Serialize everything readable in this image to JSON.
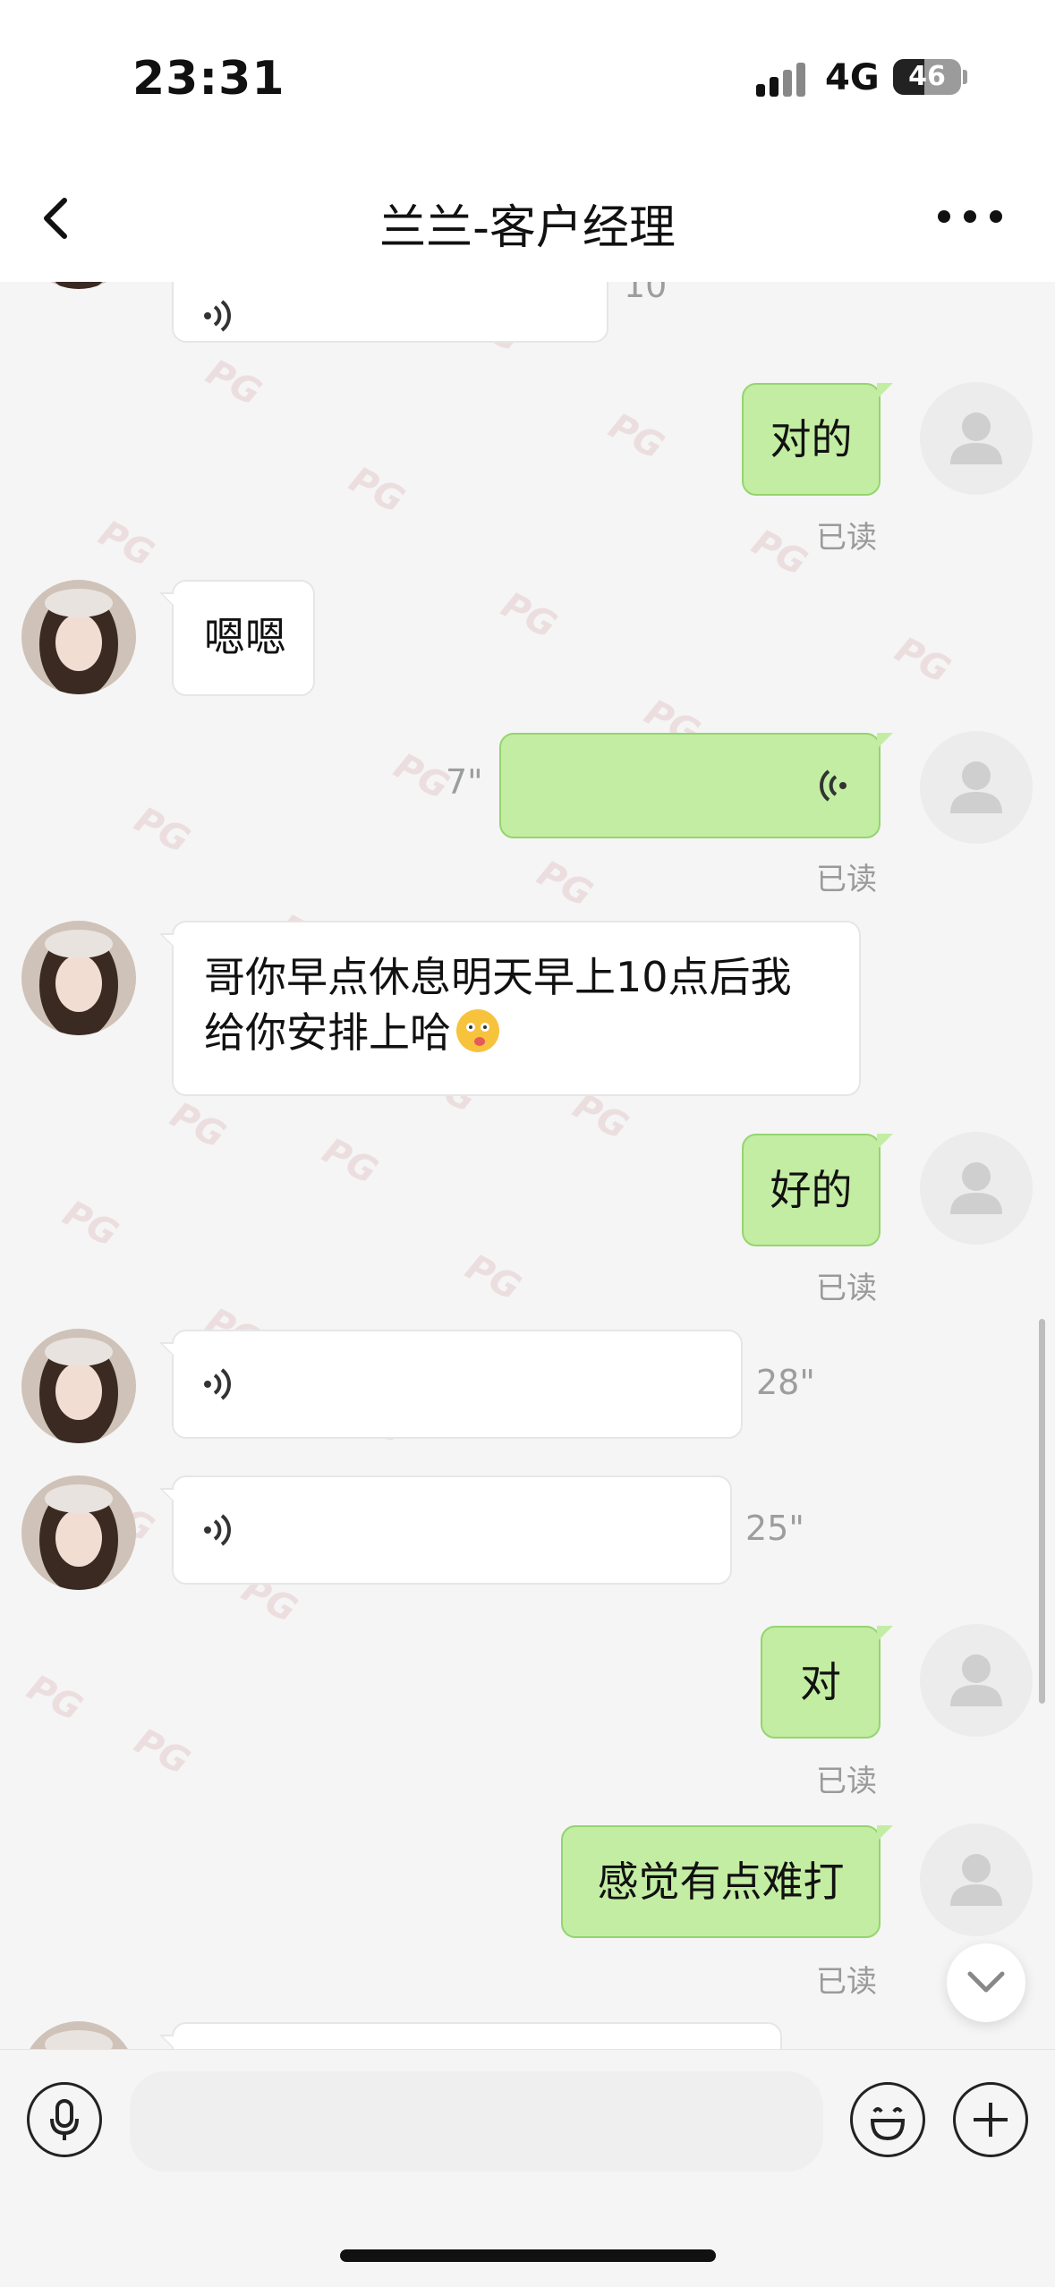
{
  "status_bar": {
    "time": "23:31",
    "network": "4G",
    "battery": "46"
  },
  "nav": {
    "title": "兰兰-客户经理"
  },
  "messages": {
    "m0_duration": "10\"",
    "m1_text": "对的",
    "m1_status": "已读",
    "m2_text": "嗯嗯",
    "m3_duration": "7\"",
    "m3_status": "已读",
    "m4_line1": "哥你早点休息明天早上10点后我",
    "m4_line2": "给你安排上哈",
    "m5_text": "好的",
    "m5_status": "已读",
    "m6_duration": "28\"",
    "m7_duration": "25\"",
    "m8_text": "对",
    "m8_status": "已读",
    "m9_text": "感觉有点难打",
    "m9_status": "已读"
  },
  "watermark": "PG",
  "input": {
    "placeholder": ""
  },
  "colors": {
    "sent_bubble": "#c3eda3",
    "sent_border": "#95d46f",
    "received_bubble": "#ffffff",
    "background": "#f5f5f5"
  }
}
